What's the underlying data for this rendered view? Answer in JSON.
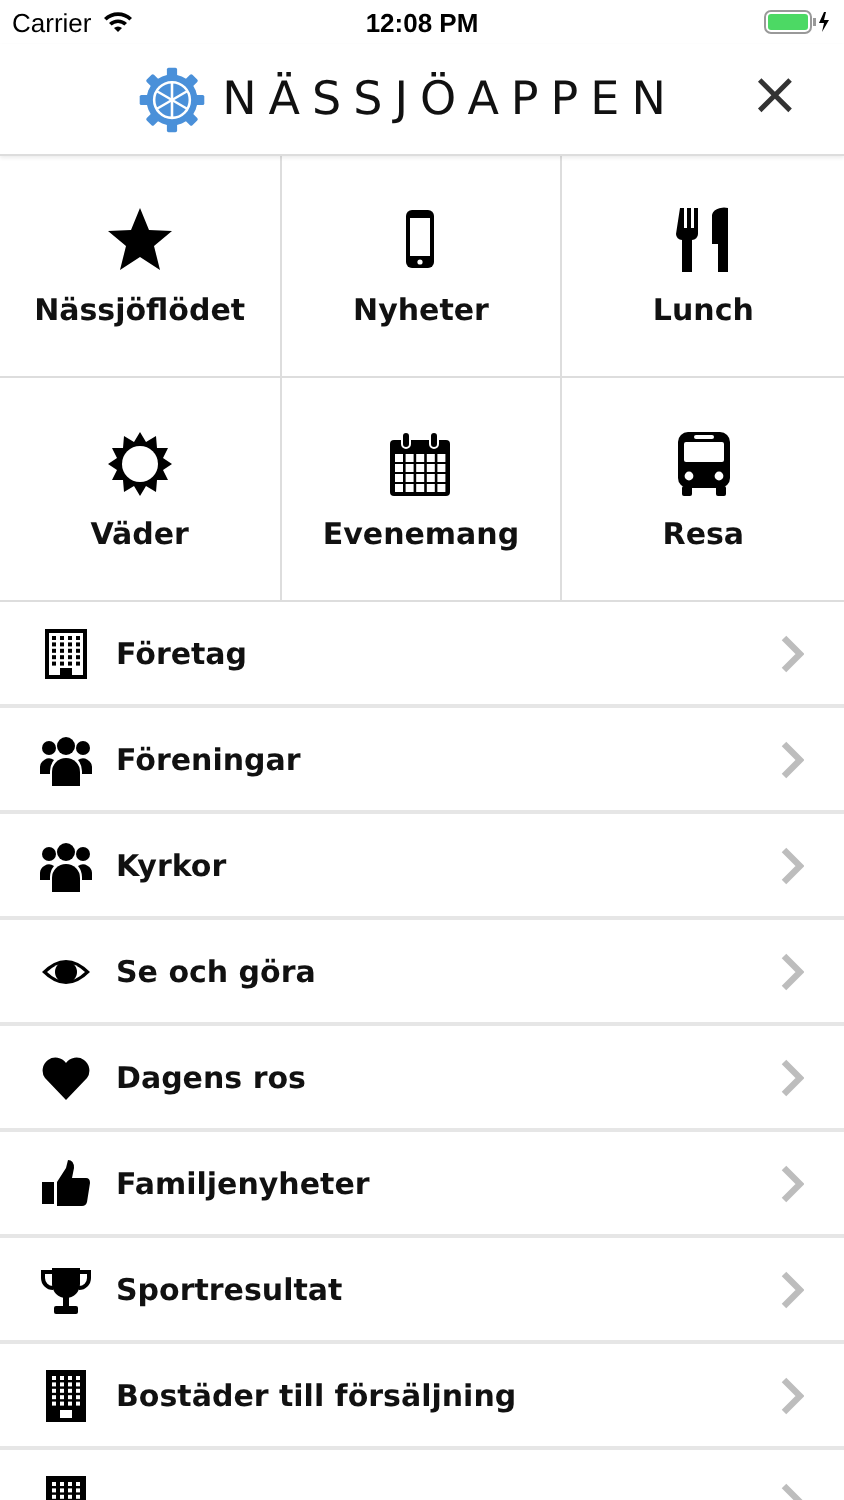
{
  "status_bar": {
    "carrier": "Carrier",
    "time": "12:08 PM"
  },
  "header": {
    "title": "NÄSSJÖAPPEN",
    "close": "×"
  },
  "tiles": [
    {
      "label": "Nässjöflödet",
      "kind": "star"
    },
    {
      "label": "Nyheter",
      "kind": "phone"
    },
    {
      "label": "Lunch",
      "kind": "cutlery"
    },
    {
      "label": "Väder",
      "kind": "sun"
    },
    {
      "label": "Evenemang",
      "kind": "calendar"
    },
    {
      "label": "Resa",
      "kind": "bus"
    }
  ],
  "menu": [
    {
      "label": "Företag",
      "kind": "building"
    },
    {
      "label": "Föreningar",
      "kind": "group"
    },
    {
      "label": "Kyrkor",
      "kind": "group"
    },
    {
      "label": "Se och göra",
      "kind": "eye"
    },
    {
      "label": "Dagens ros",
      "kind": "heart"
    },
    {
      "label": "Familjenyheter",
      "kind": "thumb"
    },
    {
      "label": "Sportresultat",
      "kind": "trophy"
    },
    {
      "label": "Bostäder till försäljning",
      "kind": "tower"
    },
    {
      "kind": "tower"
    }
  ]
}
